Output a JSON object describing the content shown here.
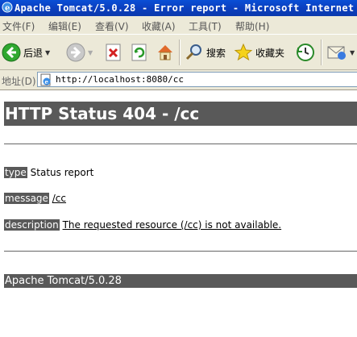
{
  "window": {
    "title": "Apache Tomcat/5.0.28 - Error report - Microsoft Internet Explorer"
  },
  "menu": {
    "items": [
      "文件(F)",
      "编辑(E)",
      "查看(V)",
      "收藏(A)",
      "工具(T)",
      "帮助(H)"
    ]
  },
  "toolbar": {
    "back_label": "后退",
    "search_label": "搜索",
    "favorites_label": "收藏夹",
    "icons": [
      "back-arrow",
      "forward-arrow",
      "stop",
      "refresh",
      "home",
      "search",
      "favorites",
      "history",
      "mail"
    ]
  },
  "address": {
    "label": "地址(D)",
    "url": "http://localhost:8080/cc"
  },
  "page": {
    "heading": "HTTP Status 404 - /cc",
    "type_label": "type",
    "type_value": "Status report",
    "message_label": "message",
    "message_value": "/cc",
    "description_label": "description",
    "description_value": "The requested resource (/cc) is not available.",
    "footer": "Apache Tomcat/5.0.28"
  },
  "colors": {
    "title_bar": "#0b3fbf",
    "chrome": "#ece9d8",
    "label_bg": "#595959"
  }
}
